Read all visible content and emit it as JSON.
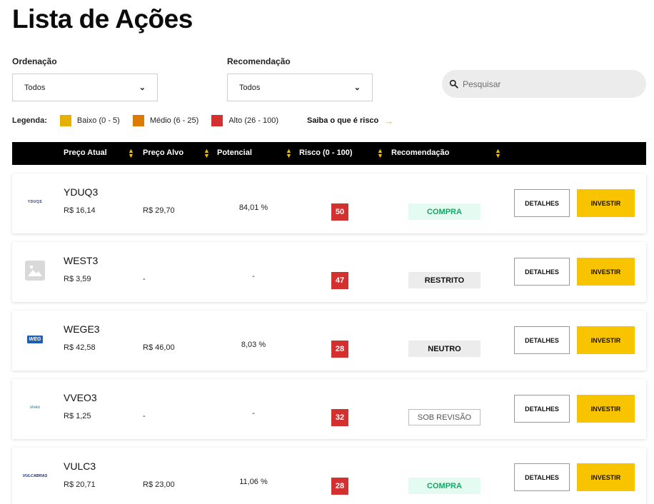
{
  "page": {
    "title": "Lista de Ações"
  },
  "filters": {
    "ordenacao": {
      "label": "Ordenação",
      "value": "Todos"
    },
    "recomendacao": {
      "label": "Recomendação",
      "value": "Todos"
    },
    "search": {
      "placeholder": "Pesquisar"
    }
  },
  "legend": {
    "title": "Legenda:",
    "items": [
      {
        "label": "Baixo (0 - 5)",
        "color": "#E5B000"
      },
      {
        "label": "Médio (6 - 25)",
        "color": "#DD7A00"
      },
      {
        "label": "Alto (26 - 100)",
        "color": "#D33030"
      }
    ],
    "link": "Saiba o que é risco",
    "link_arrow": "→"
  },
  "table": {
    "headers": [
      "Preço Atual",
      "Preço Alvo",
      "Potencial",
      "Risco (0 - 100)",
      "Recomendação"
    ],
    "rows": [
      {
        "ticker": "YDUQ3",
        "logo": "yduqs-logo",
        "logo_text": "YDUQS",
        "price": "R$ 16,14",
        "target": "R$ 29,70",
        "potential": "84,01 %",
        "risk": "50",
        "recommendation": "COMPRA",
        "rec_style": "compra",
        "details": "DETALHES",
        "invest": "INVESTIR"
      },
      {
        "ticker": "WEST3",
        "logo": "image-placeholder-icon",
        "logo_text": "",
        "price": "R$ 3,59",
        "target": "-",
        "potential": "-",
        "risk": "47",
        "recommendation": "RESTRITO",
        "rec_style": "restrito",
        "details": "DETALHES",
        "invest": "INVESTIR"
      },
      {
        "ticker": "WEGE3",
        "logo": "weg-logo",
        "logo_text": "WEG",
        "price": "R$ 42,58",
        "target": "R$ 46,00",
        "potential": "8,03 %",
        "risk": "28",
        "recommendation": "NEUTRO",
        "rec_style": "neutro",
        "details": "DETALHES",
        "invest": "INVESTIR"
      },
      {
        "ticker": "VVEO3",
        "logo": "viveo-logo",
        "logo_text": "viveo",
        "price": "R$ 1,25",
        "target": "-",
        "potential": "-",
        "risk": "32",
        "recommendation": "SOB REVISÃO",
        "rec_style": "revisao",
        "details": "DETALHES",
        "invest": "INVESTIR"
      },
      {
        "ticker": "VULC3",
        "logo": "vulcabras-logo",
        "logo_text": "VULCABRAS",
        "price": "R$ 20,71",
        "target": "R$ 23,00",
        "potential": "11,06 %",
        "risk": "28",
        "recommendation": "COMPRA",
        "rec_style": "compra",
        "details": "DETALHES",
        "invest": "INVESTIR"
      }
    ]
  },
  "colors": {
    "accent": "#F8C400",
    "risk_high": "#D33030",
    "buy_bg": "#E3FBF0",
    "buy_text": "#10A865"
  }
}
